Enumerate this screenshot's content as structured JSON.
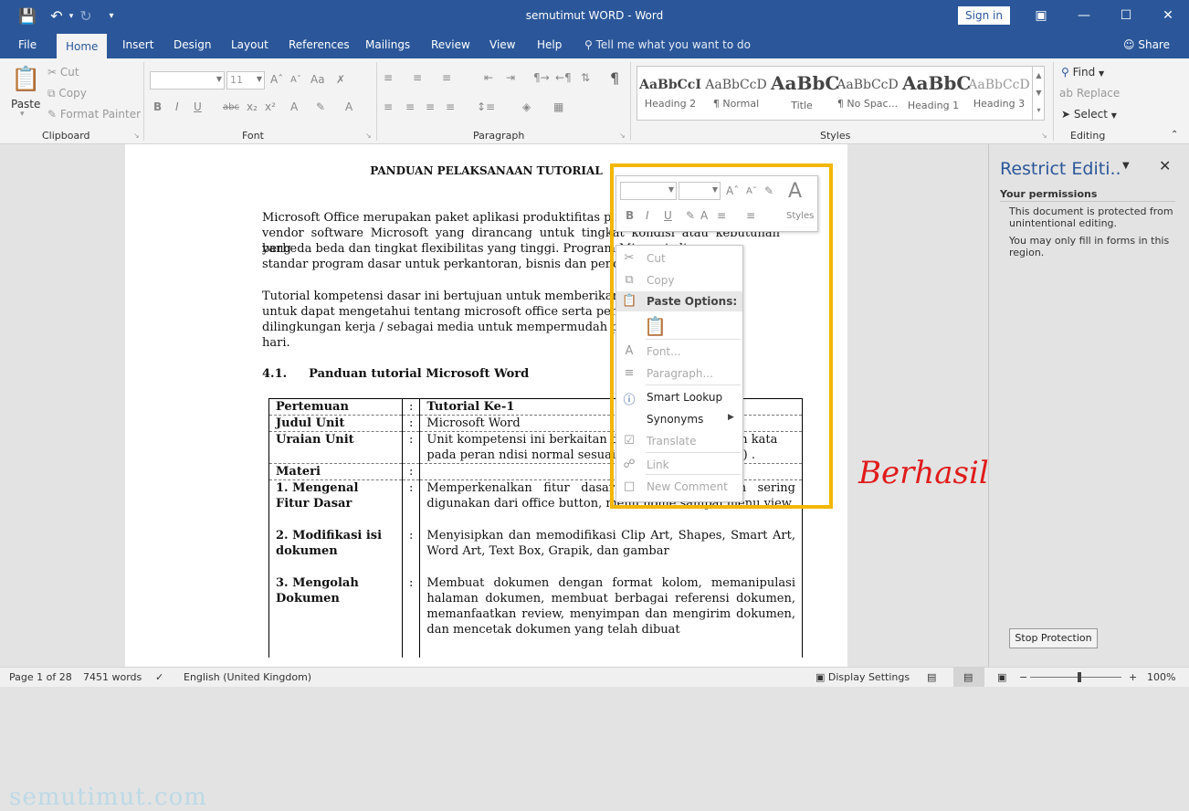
{
  "window": {
    "title": "semutimut WORD  -  Word",
    "signin": "Sign in"
  },
  "tabs": [
    "File",
    "Home",
    "Insert",
    "Design",
    "Layout",
    "References",
    "Mailings",
    "Review",
    "View",
    "Help"
  ],
  "tellme": "Tell me what you want to do",
  "share": "Share",
  "ribbon": {
    "clipboard": {
      "paste": "Paste",
      "cut": "Cut",
      "copy": "Copy",
      "format_painter": "Format Painter",
      "label": "Clipboard"
    },
    "font": {
      "size": "11",
      "label": "Font"
    },
    "paragraph": {
      "label": "Paragraph"
    },
    "styles": {
      "label": "Styles",
      "tiles": [
        {
          "preview": "AaBbCcI",
          "name": "Heading 2"
        },
        {
          "preview": "AaBbCcD",
          "name": "¶ Normal"
        },
        {
          "preview": "AaBbC",
          "name": "Title"
        },
        {
          "preview": "AaBbCcD",
          "name": "¶ No Spac..."
        },
        {
          "preview": "AaBbC",
          "name": "Heading 1"
        },
        {
          "preview": "AaBbCcD",
          "name": "Heading 3"
        }
      ]
    },
    "editing": {
      "find": "Find",
      "replace": "Replace",
      "select": "Select",
      "label": "Editing"
    }
  },
  "document": {
    "heading": "PANDUAN PELAKSANAAN TUTORIAL",
    "para1": [
      "Microsoft  Office  merupakan paket aplikasi produktifitas p",
      "vendor software Microsoft yang dirancang untuk tingkat kondisi atau kebutuhan yang",
      "berbeda beda dan tingkat flexibilitas yang tinggi. Program Mi              menjadi",
      "standar program dasar untuk perkantoran, bisnis dan pendidi"
    ],
    "para2": [
      "Tutorial kompetensi dasar ini bertujuan untuk memberikan                    asiswa",
      "untuk dapat mengetahui tentang microsoft office serta peng                  bantu",
      "dilingkungan kerja / sebagai media untuk mempermudah pr                  sehari-",
      "hari."
    ],
    "section_no": "4.1.",
    "section_title": "Panduan tutorial Microsoft Word",
    "table": [
      {
        "a": "Pertemuan",
        "b": ":",
        "c": "Tutorial Ke-1",
        "bold_c": true
      },
      {
        "a": "Judul Unit",
        "b": ":",
        "c": "Microsoft Word"
      },
      {
        "a": "Uraian Unit",
        "b": ":",
        "c": "Unit kompetensi ini berkaitan d                    ranti lunak pengolah kata pada peran                    ndisi normal sesuai dengan Petunjuk                    ual) ."
      },
      {
        "a": "Materi",
        "b": ":",
        "c": ""
      },
      {
        "a": "1.    Mengenal Fitur Dasar",
        "b": ":",
        "c": "Memperkenalkan fitur dasar yang penting dan sering digunakan dari office button, menu home sampai menu view."
      },
      {
        "a": "2.    Modifikasi isi dokumen",
        "b": ":",
        "c": "Menyisipkan dan memodifikasi Clip Art, Shapes, Smart Art, Word Art, Text Box, Grapik, dan gambar"
      },
      {
        "a": "3.    Mengolah Dokumen",
        "b": ":",
        "c": "Membuat dokumen dengan format kolom, memanipulasi halaman dokumen, membuat berbagai referensi dokumen, memanfaatkan review, menyimpan dan mengirim dokumen, dan mencetak dokumen yang telah dibuat"
      }
    ]
  },
  "mini_toolbar": {
    "styles": "Styles"
  },
  "context_menu": {
    "cut": "Cut",
    "copy": "Copy",
    "paste_options": "Paste Options:",
    "font": "Font...",
    "paragraph": "Paragraph...",
    "smart_lookup": "Smart Lookup",
    "synonyms": "Synonyms",
    "translate": "Translate",
    "link": "Link",
    "new_comment": "New Comment"
  },
  "annotation": "Berhasil",
  "watermark": "semutimut.com",
  "taskpane": {
    "title": "Restrict Editi..",
    "permissions": "Your permissions",
    "msg1": "This document is protected from unintentional editing.",
    "msg2": "You may only fill in forms in this region.",
    "stop": "Stop Protection"
  },
  "status": {
    "page": "Page 1 of 28",
    "words": "7451 words",
    "language": "English (United Kingdom)",
    "display": "Display Settings",
    "zoom": "100%"
  }
}
